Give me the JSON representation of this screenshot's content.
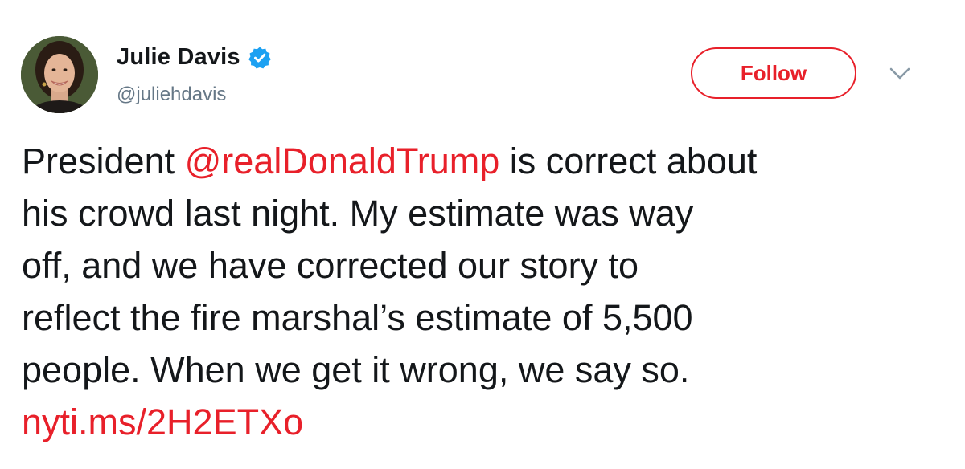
{
  "author": {
    "display_name": "Julie Davis",
    "handle": "@juliehdavis",
    "verified_icon": "verified-badge-icon",
    "avatar_icon": "profile-photo"
  },
  "actions": {
    "follow_label": "Follow",
    "menu_icon": "chevron-down-icon"
  },
  "tweet": {
    "line1_pre": "President ",
    "mention": "@realDonaldTrump",
    "line1_post": " is correct about",
    "line2": "his crowd last night. My estimate was way",
    "line3": "off, and we have corrected our story to",
    "line4": "reflect the fire marshal’s estimate of 5,500",
    "line5": "people. When we get it wrong, we say so.",
    "link": "nyti.ms/2H2ETXo"
  },
  "colors": {
    "accent": "#e8202a",
    "verified": "#1da1f2",
    "text": "#14171a",
    "muted": "#657786"
  }
}
